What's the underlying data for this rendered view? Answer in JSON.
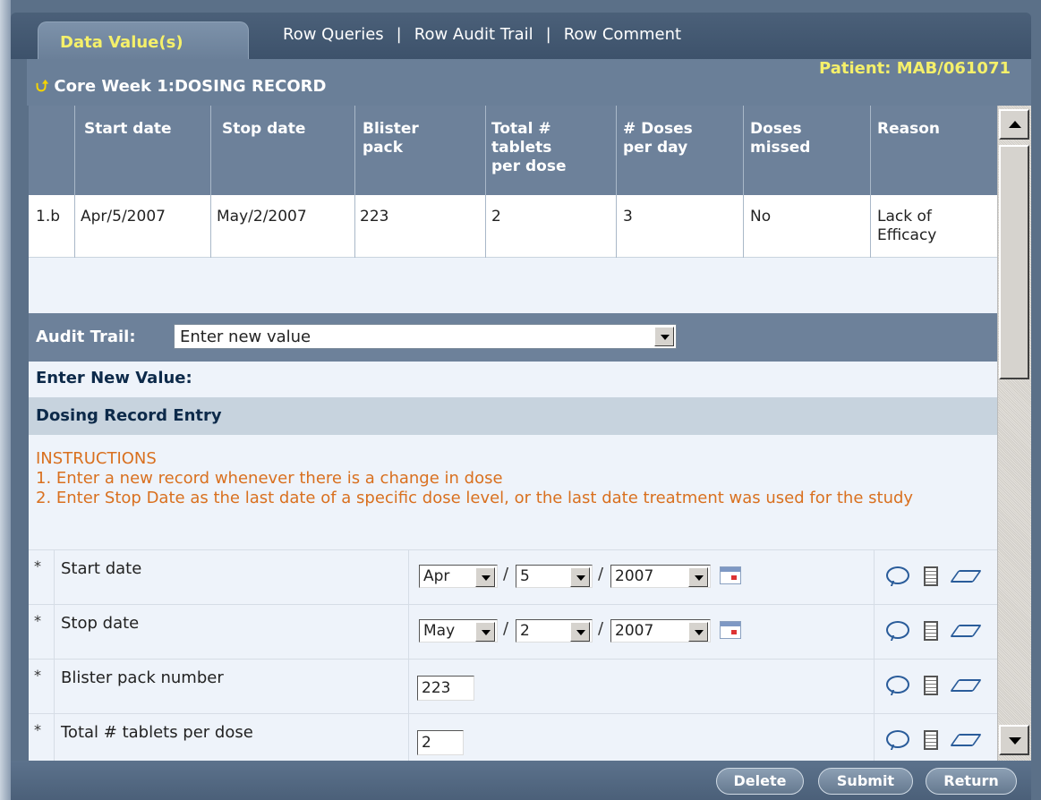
{
  "tabs": {
    "active": "Data Value(s)",
    "links": [
      "Row Queries",
      "Row Audit Trail",
      "Row Comment"
    ]
  },
  "patient": "Patient: MAB/061071",
  "breadcrumb": "Core Week 1:DOSING RECORD",
  "grid": {
    "headers": [
      "Start date",
      "Stop date",
      "Blister pack",
      "Total # tablets per dose",
      "# Doses per day",
      "Doses missed",
      "Reason"
    ],
    "header_lines": [
      [
        "Start date"
      ],
      [
        "Stop date"
      ],
      [
        "Blister",
        "pack"
      ],
      [
        "Total #",
        "tablets",
        "per dose"
      ],
      [
        "# Doses",
        "per day"
      ],
      [
        "Doses",
        "missed"
      ],
      [
        "Reason"
      ]
    ],
    "row": {
      "id": "1.b",
      "cells": [
        "Apr/5/2007",
        "May/2/2007",
        "223",
        "2",
        "3",
        "No",
        "Lack of Efficacy"
      ],
      "reason_lines": [
        "Lack of",
        "Efficacy"
      ]
    }
  },
  "audit_trail": {
    "label": "Audit Trail:",
    "value": "Enter new value"
  },
  "enter_new_value": "Enter New Value:",
  "section_title": "Dosing Record Entry",
  "instructions": [
    "INSTRUCTIONS",
    "1. Enter a new record whenever there is a change in dose",
    "2. Enter Stop Date as the last date of a specific dose level, or the last date treatment was used for the study"
  ],
  "form": {
    "required_mark": "*",
    "start_date": {
      "label": "Start date",
      "month": "Apr",
      "day": "5",
      "year": "2007"
    },
    "stop_date": {
      "label": "Stop date",
      "month": "May",
      "day": "2",
      "year": "2007"
    },
    "blister": {
      "label": "Blister pack number",
      "value": "223"
    },
    "tablets": {
      "label": "Total # tablets per dose",
      "value": "2"
    },
    "date_sep": "/"
  },
  "buttons": {
    "delete": "Delete",
    "submit": "Submit",
    "return": "Return"
  },
  "icons": {
    "up_arrow": "up-arrow-icon",
    "comment": "comment-bubble-icon",
    "copy": "copy-icon",
    "erase": "eraser-icon",
    "calendar": "calendar-icon"
  }
}
